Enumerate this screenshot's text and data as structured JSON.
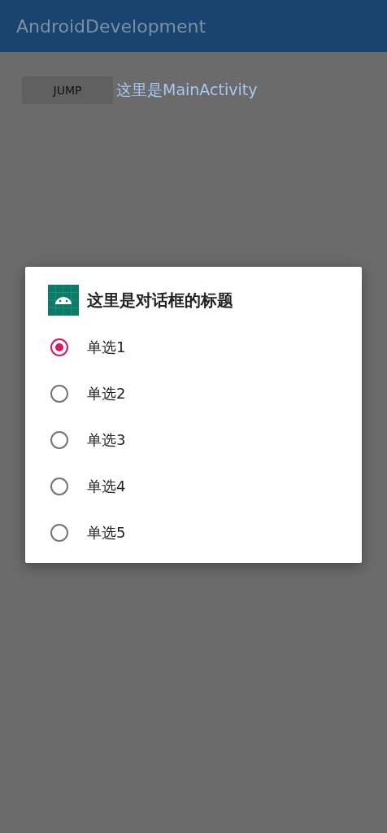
{
  "app_bar": {
    "title": "AndroidDevelopment"
  },
  "content": {
    "button": "JUMP",
    "text": "这里是MainActivity"
  },
  "dialog": {
    "title": "这里是对话框的标题",
    "options": [
      {
        "label": "单选1",
        "selected": true
      },
      {
        "label": "单选2",
        "selected": false
      },
      {
        "label": "单选3",
        "selected": false
      },
      {
        "label": "单选4",
        "selected": false
      },
      {
        "label": "单选5",
        "selected": false
      }
    ]
  }
}
